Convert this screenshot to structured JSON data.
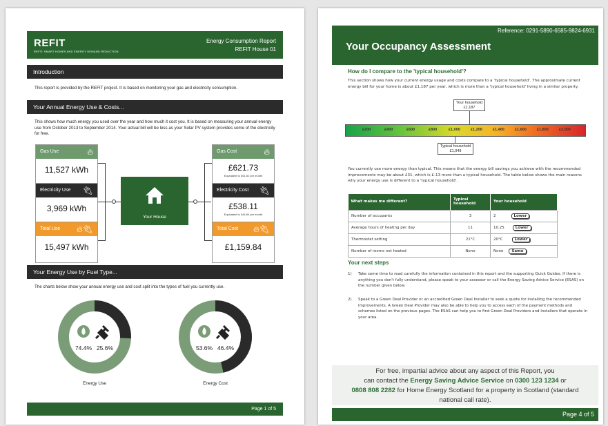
{
  "page1": {
    "header": {
      "logo": "REFIT",
      "logo_sub": "REFIT: SMART HOMES AND ENERGY DEMAND REDUCTION",
      "title": "Energy Consumption Report",
      "subtitle": "REFIT House 01"
    },
    "intro": {
      "heading": "Introduction",
      "text": "This report is provided by the REFIT project. It is based on monitoring your gas and electricity consumption."
    },
    "annual": {
      "heading": "Your Annual Energy Use & Costs...",
      "text": "This shows how much energy you used over the year and how much it cost you. It is based on measuring your annual energy use from October 2013 to September 2014. Your actual bill will be less as your Solar PV system provides some of the electricity for free."
    },
    "use_boxes": [
      {
        "label": "Gas Use",
        "value": "11,527 kWh",
        "icon": "flame-icon",
        "color": "#6e9a6e"
      },
      {
        "label": "Electricity Use",
        "value": "3,969 kWh",
        "icon": "plug-icon",
        "color": "#2b2b2b"
      },
      {
        "label": "Total Use",
        "value": "15,497 kWh",
        "icon": "flame-plug-icon",
        "color": "#f19a2b"
      }
    ],
    "house_label": "Your House",
    "cost_boxes": [
      {
        "label": "Gas Cost",
        "value": "£621.73",
        "note": "Equivalent to £51.81 per month",
        "icon": "flame-icon",
        "color": "#6e9a6e"
      },
      {
        "label": "Electricity Cost",
        "value": "£538.11",
        "note": "Equivalent to £44.84 per month",
        "icon": "plug-icon",
        "color": "#2b2b2b"
      },
      {
        "label": "Total Cost",
        "value": "£1,159.84",
        "note": "",
        "icon": "flame-plug-icon",
        "color": "#f19a2b"
      }
    ],
    "fuel": {
      "heading": "Your Energy Use by Fuel Type...",
      "text": "The charts below show your annual energy use and cost split into the types of fuel you currently use."
    },
    "donuts": [
      {
        "label": "Energy Use",
        "gas_pct": 74.4,
        "elec_pct": 25.6,
        "gas_text": "74.4%",
        "elec_text": "25.6%"
      },
      {
        "label": "Energy Cost",
        "gas_pct": 53.6,
        "elec_pct": 46.4,
        "gas_text": "53.6%",
        "elec_text": "46.4%"
      }
    ],
    "footer": "Page 1 of 5"
  },
  "page2": {
    "ref": "Reference: 0291-5890-6585-9824-6931",
    "title": "Your Occupancy Assessment",
    "compare_heading": "How do I compare to the 'typical household'?",
    "compare_text": "This section shows how your current energy usage and costs compare to a 'typical household'. The approximate current energy bill for your home is about £1,187 per year, which is more than a 'typical household' living in a similar property.",
    "scale_ticks": [
      "£200",
      "£400",
      "£600",
      "£800",
      "£1,000",
      "£1,200",
      "£1,400",
      "£1,600",
      "£1,800",
      "£2,000"
    ],
    "your_household": {
      "label": "Your household",
      "value": "£1,187"
    },
    "typical_household": {
      "label": "Typical household",
      "value": "£1,049"
    },
    "more_text": "You currently use more energy than typical. This means that the energy bill savings you achieve with the recommended improvements may be about £31, which is £-13 more than a typical household. The table below shows the main reasons why your energy use is different to a 'typical household'.",
    "table": {
      "headers": [
        "What makes me different?",
        "Typical household",
        "Your household"
      ],
      "rows": [
        {
          "label": "Number of occupants",
          "typical": "3",
          "yours": "2",
          "badge": "Lower"
        },
        {
          "label": "Average hours of heating per day",
          "typical": "11",
          "yours": "10.25",
          "badge": "Lower"
        },
        {
          "label": "Thermostat setting",
          "typical": "21°C",
          "yours": "20°C",
          "badge": "Lower"
        },
        {
          "label": "Number of rooms not heated",
          "typical": "None",
          "yours": "None",
          "badge": "Same"
        }
      ]
    },
    "next_heading": "Your next steps",
    "steps": [
      {
        "n": "1)",
        "text": "Take some time to read carefully the information contained in this report and the supporting Quick Guides. If there is anything you don't fully understand, please speak to your assessor or call the Energy Saving Advice Service (ESAS) on the number given below."
      },
      {
        "n": "2)",
        "text": "Speak to a Green Deal Provider or an accredited Green Deal Installer to seek a quote for installing the recommended improvements. A Green Deal Provider may also be able to help you to access each of the payment methods and schemes listed on the previous pages. The ESAS can help you to find Green Deal Providers and Installers that operate in your area."
      }
    ],
    "advice": {
      "line1": "For free, impartial advice about any aspect of this Report, you",
      "line2a": "can contact the",
      "line2b": "Energy Saving Advice Service",
      "line2c": "on",
      "line2d": "0300 123 1234",
      "line2e": "or",
      "line3a": "0808 808 2282",
      "line3b": "for Home Energy Scotland for a property in Scotland (standard",
      "line4": "national call rate)."
    },
    "footer": "Page 4 of 5"
  }
}
